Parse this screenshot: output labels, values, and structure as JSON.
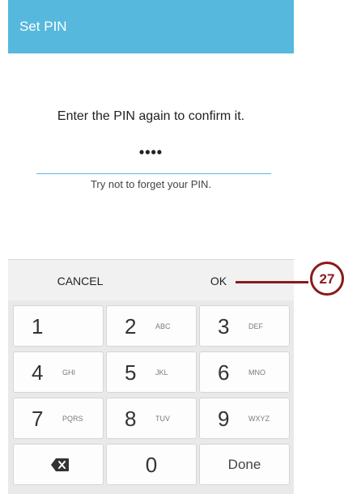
{
  "appbar": {
    "title": "Set PIN"
  },
  "pin_screen": {
    "prompt": "Enter the PIN again to confirm it.",
    "pin_value": "••••",
    "hint": "Try not to forget your PIN."
  },
  "actions": {
    "cancel": "CANCEL",
    "ok": "OK"
  },
  "keypad": {
    "keys": [
      {
        "digit": "1",
        "letters": ""
      },
      {
        "digit": "2",
        "letters": "ABC"
      },
      {
        "digit": "3",
        "letters": "DEF"
      },
      {
        "digit": "4",
        "letters": "GHI"
      },
      {
        "digit": "5",
        "letters": "JKL"
      },
      {
        "digit": "6",
        "letters": "MNO"
      },
      {
        "digit": "7",
        "letters": "PQRS"
      },
      {
        "digit": "8",
        "letters": "TUV"
      },
      {
        "digit": "9",
        "letters": "WXYZ"
      },
      {
        "digit": "0",
        "letters": ""
      }
    ],
    "backspace_icon": "backspace-icon",
    "done": "Done"
  },
  "callout": {
    "number": "27",
    "color": "#8b1a1a"
  },
  "colors": {
    "accent": "#56b8dd"
  }
}
